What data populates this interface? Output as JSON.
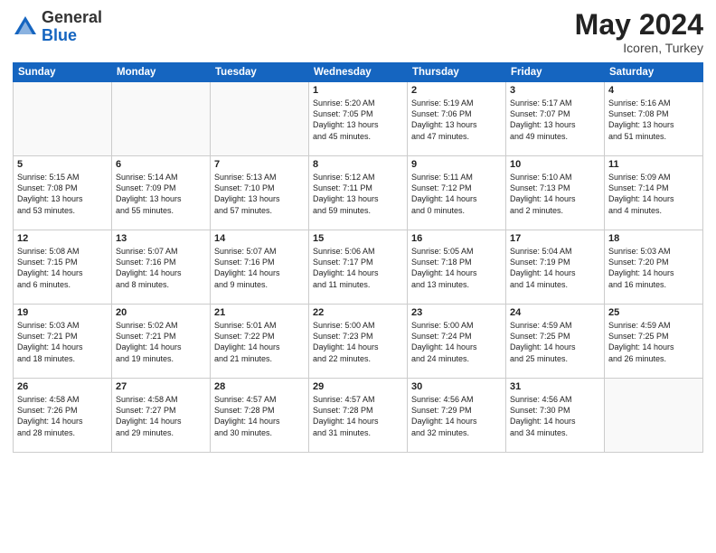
{
  "header": {
    "logo_line1": "General",
    "logo_line2": "Blue",
    "month": "May 2024",
    "location": "Icoren, Turkey"
  },
  "weekdays": [
    "Sunday",
    "Monday",
    "Tuesday",
    "Wednesday",
    "Thursday",
    "Friday",
    "Saturday"
  ],
  "weeks": [
    [
      {
        "day": "",
        "info": ""
      },
      {
        "day": "",
        "info": ""
      },
      {
        "day": "",
        "info": ""
      },
      {
        "day": "1",
        "info": "Sunrise: 5:20 AM\nSunset: 7:05 PM\nDaylight: 13 hours\nand 45 minutes."
      },
      {
        "day": "2",
        "info": "Sunrise: 5:19 AM\nSunset: 7:06 PM\nDaylight: 13 hours\nand 47 minutes."
      },
      {
        "day": "3",
        "info": "Sunrise: 5:17 AM\nSunset: 7:07 PM\nDaylight: 13 hours\nand 49 minutes."
      },
      {
        "day": "4",
        "info": "Sunrise: 5:16 AM\nSunset: 7:08 PM\nDaylight: 13 hours\nand 51 minutes."
      }
    ],
    [
      {
        "day": "5",
        "info": "Sunrise: 5:15 AM\nSunset: 7:08 PM\nDaylight: 13 hours\nand 53 minutes."
      },
      {
        "day": "6",
        "info": "Sunrise: 5:14 AM\nSunset: 7:09 PM\nDaylight: 13 hours\nand 55 minutes."
      },
      {
        "day": "7",
        "info": "Sunrise: 5:13 AM\nSunset: 7:10 PM\nDaylight: 13 hours\nand 57 minutes."
      },
      {
        "day": "8",
        "info": "Sunrise: 5:12 AM\nSunset: 7:11 PM\nDaylight: 13 hours\nand 59 minutes."
      },
      {
        "day": "9",
        "info": "Sunrise: 5:11 AM\nSunset: 7:12 PM\nDaylight: 14 hours\nand 0 minutes."
      },
      {
        "day": "10",
        "info": "Sunrise: 5:10 AM\nSunset: 7:13 PM\nDaylight: 14 hours\nand 2 minutes."
      },
      {
        "day": "11",
        "info": "Sunrise: 5:09 AM\nSunset: 7:14 PM\nDaylight: 14 hours\nand 4 minutes."
      }
    ],
    [
      {
        "day": "12",
        "info": "Sunrise: 5:08 AM\nSunset: 7:15 PM\nDaylight: 14 hours\nand 6 minutes."
      },
      {
        "day": "13",
        "info": "Sunrise: 5:07 AM\nSunset: 7:16 PM\nDaylight: 14 hours\nand 8 minutes."
      },
      {
        "day": "14",
        "info": "Sunrise: 5:07 AM\nSunset: 7:16 PM\nDaylight: 14 hours\nand 9 minutes."
      },
      {
        "day": "15",
        "info": "Sunrise: 5:06 AM\nSunset: 7:17 PM\nDaylight: 14 hours\nand 11 minutes."
      },
      {
        "day": "16",
        "info": "Sunrise: 5:05 AM\nSunset: 7:18 PM\nDaylight: 14 hours\nand 13 minutes."
      },
      {
        "day": "17",
        "info": "Sunrise: 5:04 AM\nSunset: 7:19 PM\nDaylight: 14 hours\nand 14 minutes."
      },
      {
        "day": "18",
        "info": "Sunrise: 5:03 AM\nSunset: 7:20 PM\nDaylight: 14 hours\nand 16 minutes."
      }
    ],
    [
      {
        "day": "19",
        "info": "Sunrise: 5:03 AM\nSunset: 7:21 PM\nDaylight: 14 hours\nand 18 minutes."
      },
      {
        "day": "20",
        "info": "Sunrise: 5:02 AM\nSunset: 7:21 PM\nDaylight: 14 hours\nand 19 minutes."
      },
      {
        "day": "21",
        "info": "Sunrise: 5:01 AM\nSunset: 7:22 PM\nDaylight: 14 hours\nand 21 minutes."
      },
      {
        "day": "22",
        "info": "Sunrise: 5:00 AM\nSunset: 7:23 PM\nDaylight: 14 hours\nand 22 minutes."
      },
      {
        "day": "23",
        "info": "Sunrise: 5:00 AM\nSunset: 7:24 PM\nDaylight: 14 hours\nand 24 minutes."
      },
      {
        "day": "24",
        "info": "Sunrise: 4:59 AM\nSunset: 7:25 PM\nDaylight: 14 hours\nand 25 minutes."
      },
      {
        "day": "25",
        "info": "Sunrise: 4:59 AM\nSunset: 7:25 PM\nDaylight: 14 hours\nand 26 minutes."
      }
    ],
    [
      {
        "day": "26",
        "info": "Sunrise: 4:58 AM\nSunset: 7:26 PM\nDaylight: 14 hours\nand 28 minutes."
      },
      {
        "day": "27",
        "info": "Sunrise: 4:58 AM\nSunset: 7:27 PM\nDaylight: 14 hours\nand 29 minutes."
      },
      {
        "day": "28",
        "info": "Sunrise: 4:57 AM\nSunset: 7:28 PM\nDaylight: 14 hours\nand 30 minutes."
      },
      {
        "day": "29",
        "info": "Sunrise: 4:57 AM\nSunset: 7:28 PM\nDaylight: 14 hours\nand 31 minutes."
      },
      {
        "day": "30",
        "info": "Sunrise: 4:56 AM\nSunset: 7:29 PM\nDaylight: 14 hours\nand 32 minutes."
      },
      {
        "day": "31",
        "info": "Sunrise: 4:56 AM\nSunset: 7:30 PM\nDaylight: 14 hours\nand 34 minutes."
      },
      {
        "day": "",
        "info": ""
      }
    ]
  ]
}
